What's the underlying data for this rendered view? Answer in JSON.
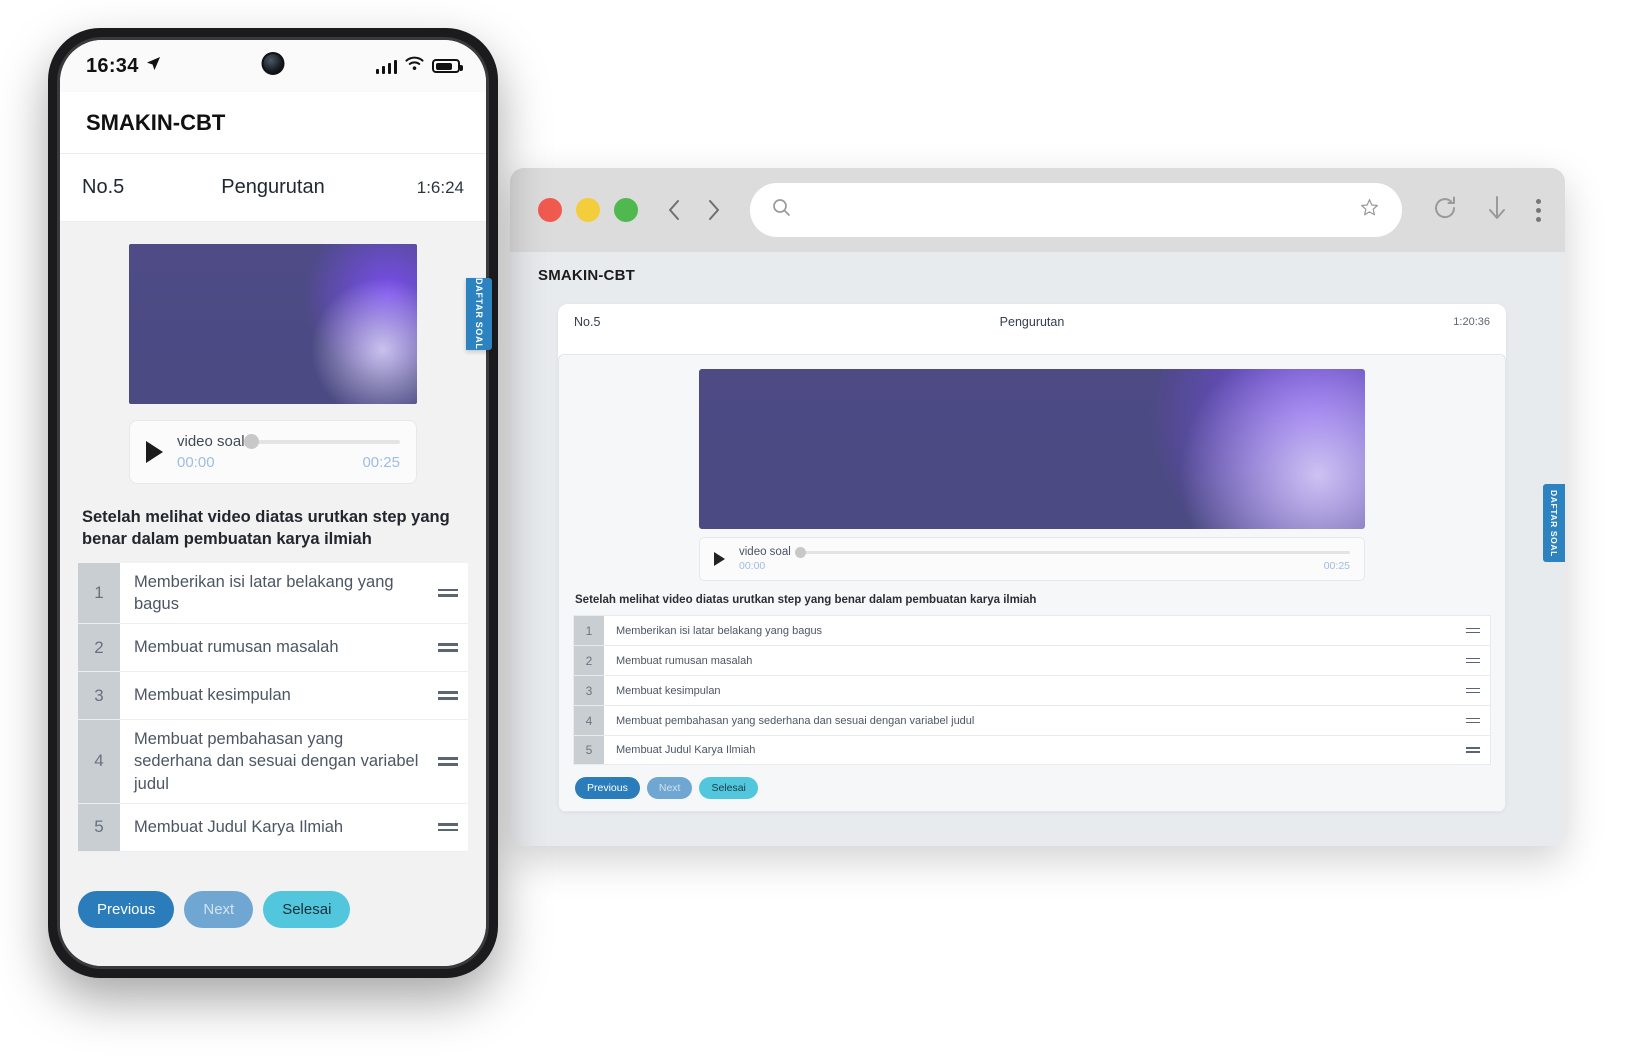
{
  "phone": {
    "status_bar": {
      "time": "16:34",
      "location_icon": "location-arrow-icon",
      "signal_icon": "signal-bars-icon",
      "wifi_icon": "wifi-icon",
      "battery_icon": "battery-icon"
    },
    "app_title": "SMAKIN-CBT",
    "question_header": {
      "number": "No.5",
      "type": "Pengurutan",
      "timer": "1:6:24"
    },
    "player": {
      "label": "video soal",
      "current_time": "00:00",
      "duration": "00:25",
      "play_icon": "play-icon"
    },
    "question_text": "Setelah melihat video diatas urutkan step yang benar dalam pembuatan karya ilmiah",
    "items": [
      {
        "num": "1",
        "text": "Memberikan isi latar belakang yang bagus"
      },
      {
        "num": "2",
        "text": "Membuat rumusan masalah"
      },
      {
        "num": "3",
        "text": "Membuat kesimpulan"
      },
      {
        "num": "4",
        "text": "Membuat pembahasan yang sederhana dan sesuai dengan variabel judul"
      },
      {
        "num": "5",
        "text": "Membuat Judul Karya Ilmiah"
      }
    ],
    "buttons": {
      "previous": "Previous",
      "next": "Next",
      "finish": "Selesai"
    },
    "soal_tab": "DAFTAR SOAL"
  },
  "browser": {
    "traffic_lights": [
      "close-red",
      "minimize-yellow",
      "maximize-green"
    ],
    "back_icon": "chevron-left-icon",
    "forward_icon": "chevron-right-icon",
    "url_value": "",
    "url_placeholder": "",
    "search_icon": "search-icon",
    "bookmark_icon": "star-icon",
    "reload_icon": "reload-icon",
    "download_icon": "download-arrow-icon",
    "menu_icon": "kebab-menu-icon"
  },
  "desktop": {
    "brand": "SMAKIN-CBT",
    "question_header": {
      "number": "No.5",
      "type": "Pengurutan",
      "timer": "1:20:36"
    },
    "player": {
      "label": "video soal",
      "current_time": "00:00",
      "duration": "00:25",
      "play_icon": "play-icon"
    },
    "question_text": "Setelah melihat video diatas urutkan step yang benar dalam pembuatan karya ilmiah",
    "items": [
      {
        "num": "1",
        "text": "Memberikan isi latar belakang yang bagus"
      },
      {
        "num": "2",
        "text": "Membuat rumusan masalah"
      },
      {
        "num": "3",
        "text": "Membuat kesimpulan"
      },
      {
        "num": "4",
        "text": "Membuat pembahasan yang sederhana dan sesuai dengan variabel judul"
      },
      {
        "num": "5",
        "text": "Membuat Judul Karya Ilmiah"
      }
    ],
    "buttons": {
      "previous": "Previous",
      "next": "Next",
      "finish": "Selesai"
    },
    "soal_tab": "DAFTAR SOAL"
  },
  "colors": {
    "primary_blue": "#2b7cba",
    "muted_blue": "#6fa6d2",
    "cyan": "#52c6dc",
    "tab_blue": "#2d83c0",
    "video_purple": "#4d4a84",
    "time_text": "#9dbde3"
  }
}
